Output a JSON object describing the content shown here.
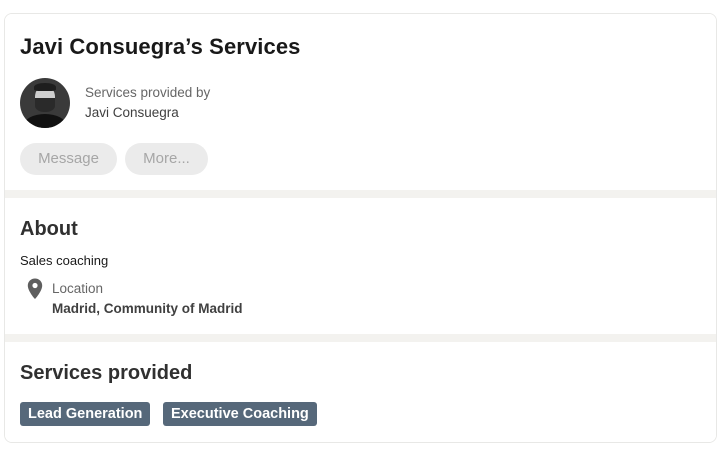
{
  "header": {
    "title": "Javi Consuegra’s Services",
    "provided_by_label": "Services provided by",
    "provider_name": "Javi Consuegra"
  },
  "actions": {
    "message_label": "Message",
    "more_label": "More..."
  },
  "about": {
    "heading": "About",
    "description": "Sales coaching",
    "location_label": "Location",
    "location_value": "Madrid, Community of Madrid"
  },
  "services": {
    "heading": "Services provided",
    "tags": [
      "Lead Generation",
      "Executive Coaching"
    ]
  },
  "colors": {
    "tag_background": "#56687a",
    "divider": "#f3f2ef",
    "disabled_button": "#ebebeb"
  },
  "icons": {
    "location": "map-pin-icon"
  }
}
